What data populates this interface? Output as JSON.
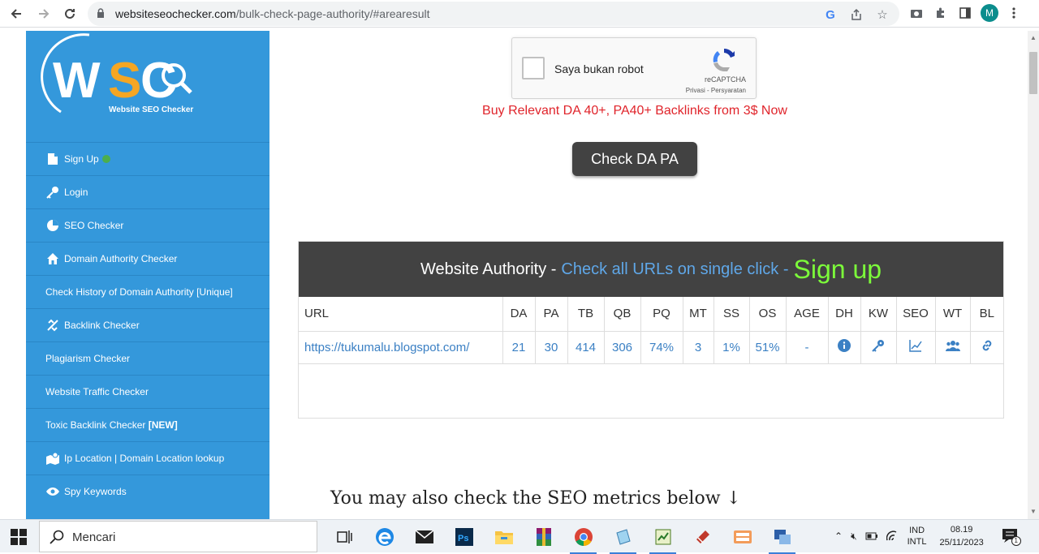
{
  "browser": {
    "url_host": "websiteseochecker.com",
    "url_path": "/bulk-check-page-authority/#arearesult",
    "avatar_letter": "M"
  },
  "sidebar": {
    "logo_letters": "WSC",
    "logo_tagline": "Website SEO Checker",
    "items": [
      {
        "label": "Sign Up",
        "icon": "signup-icon"
      },
      {
        "label": "Login",
        "icon": "key-icon"
      },
      {
        "label": "SEO Checker",
        "icon": "pie-chart-icon"
      },
      {
        "label": "Domain Authority Checker",
        "icon": "home-icon"
      },
      {
        "label": "Check History of Domain Authority [Unique]",
        "icon": ""
      },
      {
        "label": "Backlink Checker",
        "icon": "link-broken-icon"
      },
      {
        "label": "Plagiarism Checker",
        "icon": ""
      },
      {
        "label": "Website Traffic Checker",
        "icon": ""
      },
      {
        "label": "Toxic Backlink Checker",
        "badge": "[NEW]",
        "icon": ""
      },
      {
        "label": "Ip Location | Domain Location lookup",
        "icon": "location-icon"
      },
      {
        "label": "Spy Keywords",
        "icon": "eye-icon"
      }
    ]
  },
  "recaptcha": {
    "label": "Saya bukan robot",
    "brand": "reCAPTCHA",
    "links": "Privasi - Persyaratan"
  },
  "promo": "Buy Relevant DA 40+, PA40+ Backlinks from 3$ Now",
  "check_button": "Check DA PA",
  "results": {
    "title": "Website Authority -",
    "subtitle": "Check all URLs on single click -",
    "signup": "Sign up",
    "columns": [
      "URL",
      "DA",
      "PA",
      "TB",
      "QB",
      "PQ",
      "MT",
      "SS",
      "OS",
      "AGE",
      "DH",
      "KW",
      "SEO",
      "WT",
      "BL"
    ],
    "row": {
      "url": "https://tukumalu.blogspot.com/",
      "da": "21",
      "pa": "30",
      "tb": "414",
      "qb": "306",
      "pq": "74%",
      "mt": "3",
      "ss": "1%",
      "os": "51%",
      "age": "-"
    }
  },
  "seo_heading": "You may also check the SEO metrics below ↓",
  "taskbar": {
    "search_placeholder": "Mencari",
    "lang_top": "IND",
    "lang_bottom": "INTL",
    "time": "08.19",
    "date": "25/11/2023",
    "notification_count": "1"
  },
  "colors": {
    "sidebar": "#3498db",
    "promo": "#e0242b",
    "signup": "#7cfc3a",
    "link": "#3b80c4"
  }
}
